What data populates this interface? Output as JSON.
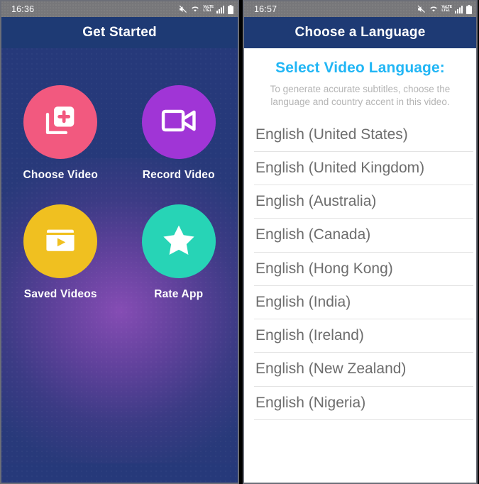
{
  "left_screen": {
    "status_bar": {
      "time": "16:36",
      "icons": [
        "mute-icon",
        "wifi-icon",
        "volte-lte-icon",
        "signal-bars-icon",
        "battery-icon"
      ],
      "volte_label_top": "VoLTE",
      "volte_label_bottom": "LTE1"
    },
    "title": "Get Started",
    "tiles": [
      {
        "label": "Choose Video",
        "icon": "library-add-icon",
        "color": "#f2597f"
      },
      {
        "label": "Record Video",
        "icon": "video-camera-icon",
        "color": "#a035d6"
      },
      {
        "label": "Saved Videos",
        "icon": "folder-play-icon",
        "color": "#f0c020"
      },
      {
        "label": "Rate App",
        "icon": "star-icon",
        "color": "#27d4b6"
      }
    ]
  },
  "right_screen": {
    "status_bar": {
      "time": "16:57",
      "icons": [
        "mute-icon",
        "wifi-icon",
        "volte-lte-icon",
        "signal-bars-icon",
        "battery-icon"
      ],
      "volte_label_top": "VoLTE",
      "volte_label_bottom": "LTE1"
    },
    "title": "Choose a Language",
    "heading": "Select Video Language:",
    "subtitle": "To generate accurate subtitles, choose the language and country accent in this video.",
    "languages": [
      "English (United States)",
      "English (United Kingdom)",
      "English (Australia)",
      "English (Canada)",
      "English (Hong Kong)",
      "English (India)",
      "English (Ireland)",
      "English (New Zealand)",
      "English (Nigeria)"
    ]
  },
  "colors": {
    "titlebar": "#1e3a74",
    "home_background": "#26397a",
    "home_glow": "#9650be",
    "statusbar": "#77777a",
    "accent_blue": "#21b6f5",
    "list_text": "#6d6d6d",
    "divider": "#e3e3e3"
  }
}
